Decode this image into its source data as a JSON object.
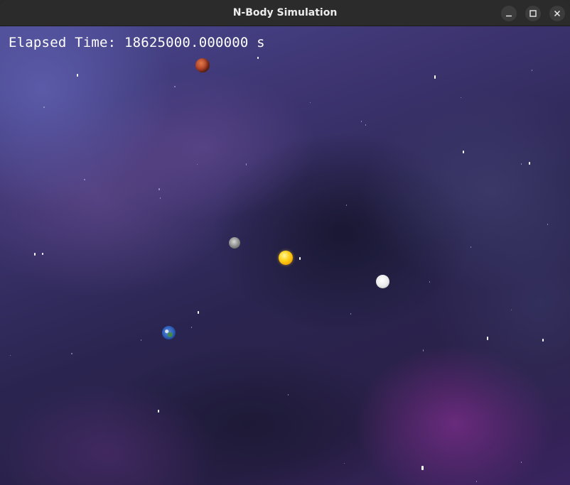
{
  "window": {
    "title": "N-Body Simulation",
    "controls": {
      "minimize_icon": "minimize-icon",
      "maximize_icon": "maximize-icon",
      "close_icon": "close-icon"
    },
    "titlebar_color": "#2b2b2b"
  },
  "simulation": {
    "elapsed_label": "Elapsed Time: 18625000.000000 s",
    "bodies": [
      "mars-icon",
      "mercury-icon",
      "sun-icon",
      "venus-icon",
      "earth-icon"
    ],
    "background": "nebula"
  }
}
